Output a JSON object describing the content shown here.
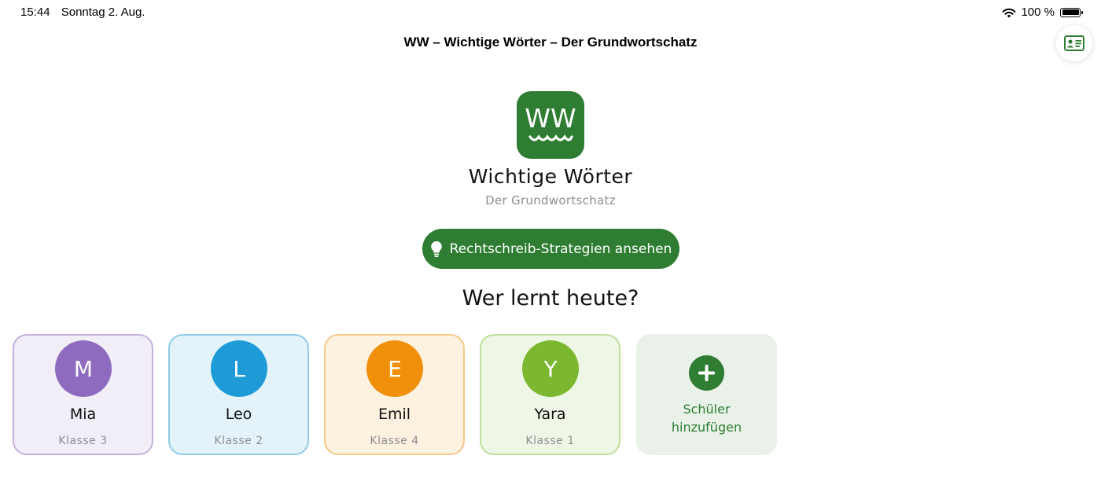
{
  "status_bar": {
    "time": "15:44",
    "date": "Sonntag 2. Aug.",
    "battery": "100 %",
    "icons": [
      "wifi-icon",
      "battery-icon"
    ]
  },
  "nav": {
    "title": "WW – Wichtige Wörter – Der Grundwortschatz",
    "profile_icon": "id-card-icon"
  },
  "app": {
    "logo_text": "WW",
    "name": "Wichtige Wörter",
    "subtitle": "Der Grundwortschatz"
  },
  "strategy_button": {
    "label": "Rechtschreib-Strategien ansehen",
    "icon": "lightbulb-icon"
  },
  "question": "Wer lernt heute?",
  "students": [
    {
      "initial": "M",
      "name": "Mia",
      "class": "Klasse 3",
      "color": "#8e6bbf",
      "bg": "#f1eef7",
      "border": "#c4b2dd"
    },
    {
      "initial": "L",
      "name": "Leo",
      "class": "Klasse 2",
      "color": "#1e9bd7",
      "bg": "#e4f3fa",
      "border": "#8fcbe8"
    },
    {
      "initial": "E",
      "name": "Emil",
      "class": "Klasse 4",
      "color": "#f0900a",
      "bg": "#fdf1e0",
      "border": "#f5c98a"
    },
    {
      "initial": "Y",
      "name": "Yara",
      "class": "Klasse 1",
      "color": "#7cb82f",
      "bg": "#eef7e5",
      "border": "#bfdf9a"
    }
  ],
  "add_student": {
    "label_line1": "Schüler",
    "label_line2": "hinzufügen",
    "icon": "plus-icon"
  },
  "colors": {
    "brand_green": "#2e7d32",
    "secondary_text": "#8e8e93"
  }
}
